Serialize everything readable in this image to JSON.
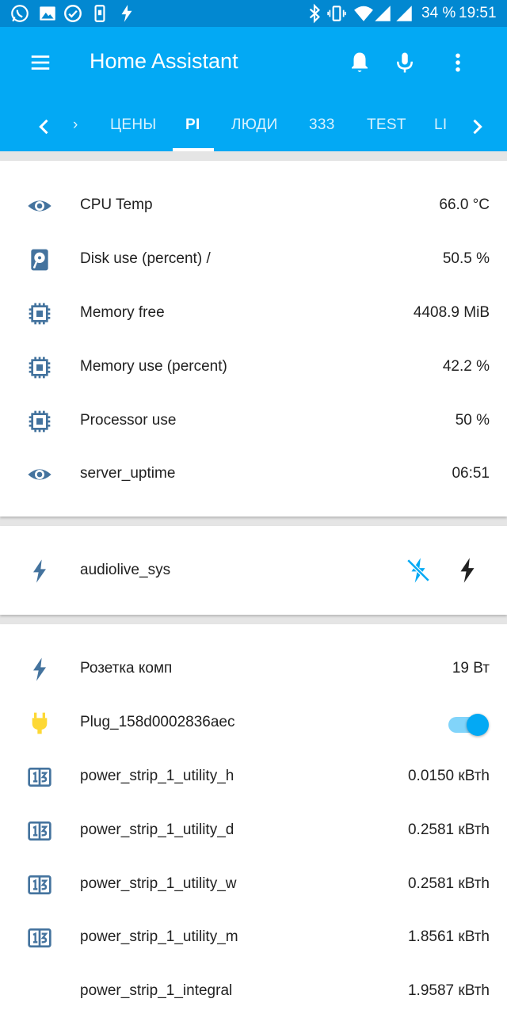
{
  "status_bar": {
    "icons": [
      "whatsapp-icon",
      "image-icon",
      "check-circle-icon",
      "phone-icon",
      "flash-icon",
      "bluetooth-icon",
      "vibrate-icon",
      "wifi-icon",
      "signal-icon",
      "signal-icon"
    ],
    "battery": "34 %",
    "time": "19:51"
  },
  "toolbar": {
    "title": "Home Assistant",
    "menu_icon": "menu-icon",
    "notifications_icon": "bell-icon",
    "voice_icon": "microphone-icon",
    "overflow_icon": "more-vertical-icon"
  },
  "tabs": {
    "items": [
      {
        "label": "›"
      },
      {
        "label": "ЦЕНЫ"
      },
      {
        "label": "PI"
      },
      {
        "label": "ЛЮДИ"
      },
      {
        "label": "333"
      },
      {
        "label": "TEST"
      },
      {
        "label": "LI"
      }
    ],
    "active": "PI"
  },
  "system_card": {
    "rows": [
      {
        "icon": "eye-icon",
        "name": "CPU Temp",
        "value": "66.0 °C"
      },
      {
        "icon": "harddisk-icon",
        "name": "Disk use (percent) /",
        "value": "50.5 %"
      },
      {
        "icon": "chip-icon",
        "name": "Memory free",
        "value": "4408.9 MiB"
      },
      {
        "icon": "chip-icon",
        "name": "Memory use (percent)",
        "value": "42.2 %"
      },
      {
        "icon": "chip-icon",
        "name": "Processor use",
        "value": "50 %"
      },
      {
        "icon": "eye-icon",
        "name": "server_uptime",
        "value": "06:51"
      }
    ]
  },
  "audio_card": {
    "rows": [
      {
        "icon": "flash-icon",
        "name": "audiolive_sys",
        "off_icon": "flash-off-icon",
        "on_icon": "flash-icon"
      }
    ]
  },
  "power_card": {
    "rows": [
      {
        "icon": "flash-icon",
        "name": "Розетка комп",
        "value": "19 Вт"
      },
      {
        "icon": "power-plug-icon",
        "name": "Plug_158d0002836aec",
        "toggle": true
      },
      {
        "icon": "counter-icon",
        "name": "power_strip_1_utility_h",
        "value": "0.0150 кВтh"
      },
      {
        "icon": "counter-icon",
        "name": "power_strip_1_utility_d",
        "value": "0.2581 кВтh"
      },
      {
        "icon": "counter-icon",
        "name": "power_strip_1_utility_w",
        "value": "0.2581 кВтh"
      },
      {
        "icon": "counter-icon",
        "name": "power_strip_1_utility_m",
        "value": "1.8561 кВтh"
      },
      {
        "icon": "",
        "name": "power_strip_1_integral",
        "value": "1.9587 кВтh"
      }
    ]
  },
  "colors": {
    "primary": "#03a9f4",
    "primary_dark": "#0288d1",
    "icon_blue": "#44739e",
    "plug_yellow": "#fdd835",
    "toggle_on": "#03a9f4"
  }
}
